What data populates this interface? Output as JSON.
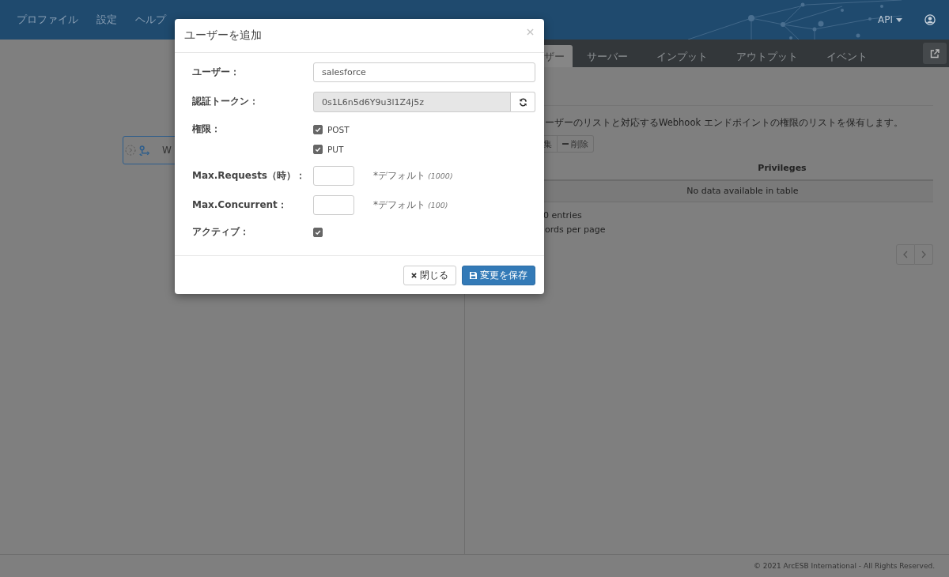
{
  "navbar": {
    "menu": [
      "プロファイル",
      "設定",
      "ヘルプ"
    ],
    "api_menu": "API"
  },
  "card": {
    "label": "W"
  },
  "tabs": [
    {
      "label": "ザー",
      "selected": true
    },
    {
      "label": "サーバー",
      "selected": false
    },
    {
      "label": "インプット",
      "selected": false
    },
    {
      "label": "アウトプット",
      "selected": false
    },
    {
      "label": "イベント",
      "selected": false
    }
  ],
  "panel": {
    "description": "ーザーのリストと対応するWebhook エンドポイントの権限のリストを保有します。",
    "buttons": [
      {
        "kind": "plain",
        "label": "集"
      },
      {
        "kind": "remove",
        "label": "削除"
      }
    ],
    "table": {
      "columns": [
        "Privileges"
      ],
      "empty": "No data available in table"
    },
    "info": "0 entries",
    "length": "ords per page"
  },
  "modal": {
    "title": "ユーザーを追加",
    "fields": [
      {
        "kind": "text",
        "label": "ユーザー：",
        "value": "salesforce"
      },
      {
        "kind": "token",
        "label": "認証トークン：",
        "value": "0s1L6n5d6Y9u3l1Z4j5z"
      },
      {
        "kind": "checks",
        "label": "権限：",
        "options": [
          {
            "label": "POST",
            "checked": true
          },
          {
            "label": "PUT",
            "checked": true
          }
        ]
      },
      {
        "kind": "number",
        "label": "Max.Requests（時）：",
        "note": "*デフォルト",
        "default": "(1000)"
      },
      {
        "kind": "number",
        "label": "Max.Concurrent：",
        "note": "*デフォルト",
        "default": "(100)"
      },
      {
        "kind": "check",
        "label": "アクティブ：",
        "checked": true
      }
    ],
    "buttons": [
      {
        "kind": "close",
        "label": "閉じる"
      },
      {
        "kind": "save",
        "label": "変更を保存"
      }
    ]
  },
  "footer": "© 2021 ArcESB International - All Rights Reserved."
}
